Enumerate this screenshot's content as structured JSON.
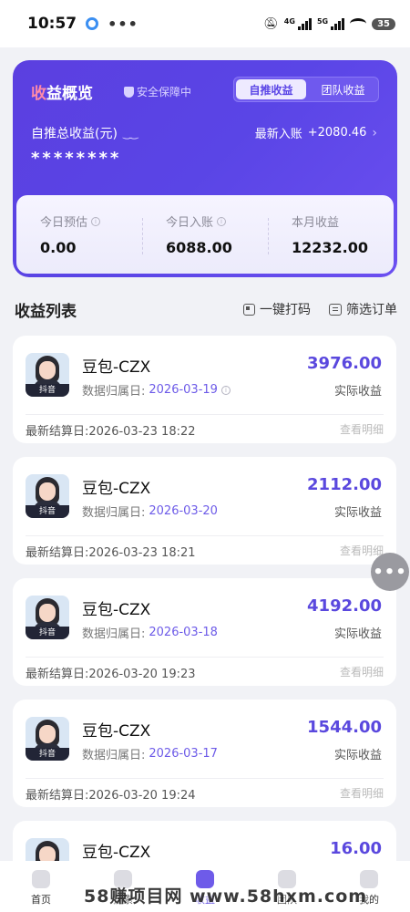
{
  "status_bar": {
    "time": "10:57",
    "dots": "•••",
    "net1": "4G",
    "net2": "5G",
    "battery": "35"
  },
  "overview": {
    "title_a": "收",
    "title_b": "益概览",
    "safety": "安全保障中",
    "tabs": [
      {
        "label": "自推收益",
        "active": true
      },
      {
        "label": "团队收益",
        "active": false
      }
    ],
    "total_label": "自推总收益(元)",
    "latest_label": "最新入账",
    "latest_value": "+2080.46",
    "hidden_value": "********",
    "stats": [
      {
        "label": "今日预估",
        "value": "0.00",
        "info": true
      },
      {
        "label": "今日入账",
        "value": "6088.00",
        "info": true
      },
      {
        "label": "本月收益",
        "value": "12232.00",
        "info": false
      }
    ]
  },
  "list": {
    "title": "收益列表",
    "action_code": "一键打码",
    "action_filter": "筛选订单",
    "amount_label": "实际收益",
    "date_prefix": "数据归属日: ",
    "detail_label": "查看明细",
    "platform_tag": "抖音",
    "items": [
      {
        "name": "豆包-CZX",
        "date": "2026-03-19",
        "amount": "3976.00",
        "settle": "最新结算日:2026-03-23 18:22"
      },
      {
        "name": "豆包-CZX",
        "date": "2026-03-20",
        "amount": "2112.00",
        "settle": "最新结算日:2026-03-23 18:21"
      },
      {
        "name": "豆包-CZX",
        "date": "2026-03-18",
        "amount": "4192.00",
        "settle": "最新结算日:2026-03-20 19:23"
      },
      {
        "name": "豆包-CZX",
        "date": "2026-03-17",
        "amount": "1544.00",
        "settle": "最新结算日:2026-03-20 19:24"
      },
      {
        "name": "豆包-CZX",
        "date": "",
        "amount": "16.00",
        "settle": ""
      }
    ]
  },
  "tabbar": {
    "items": [
      {
        "label": "首页",
        "active": false
      },
      {
        "label": "搜索",
        "active": false
      },
      {
        "label": "收益",
        "active": true
      },
      {
        "label": "团队",
        "active": false
      },
      {
        "label": "我的",
        "active": false
      }
    ]
  },
  "watermark": "58赚项目网 www.58hxm.com"
}
